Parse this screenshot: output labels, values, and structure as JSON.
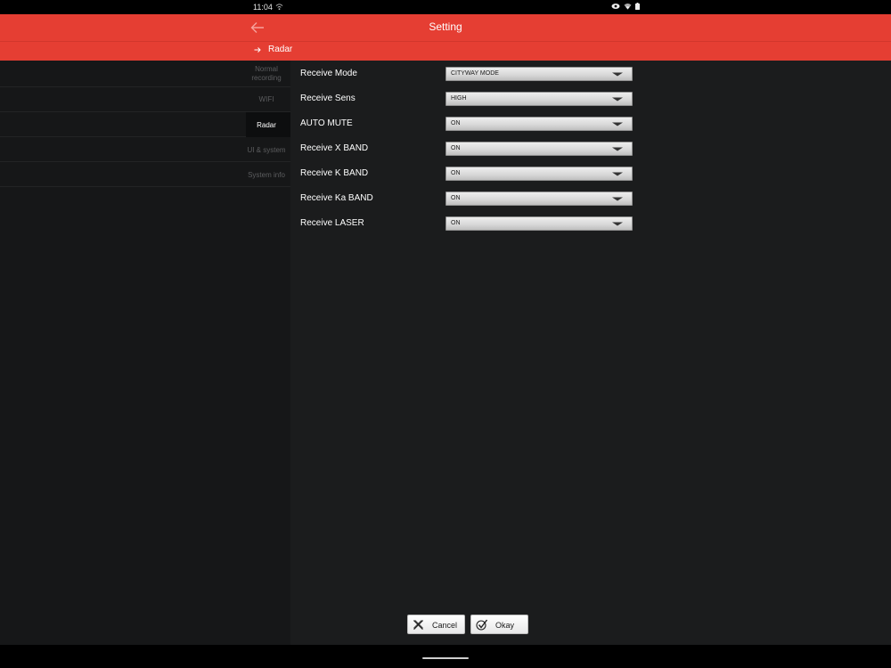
{
  "status_bar": {
    "time": "11:04"
  },
  "header": {
    "title": "Setting",
    "breadcrumb": "Radar"
  },
  "sidebar": {
    "items": [
      {
        "label": "Normal recording",
        "active": false
      },
      {
        "label": "WIFI",
        "active": false
      },
      {
        "label": "Radar",
        "active": true
      },
      {
        "label": "UI & system",
        "active": false
      },
      {
        "label": "System info",
        "active": false
      }
    ]
  },
  "settings": [
    {
      "label": "Receive Mode",
      "value": "CITYWAY MODE"
    },
    {
      "label": "Receive Sens",
      "value": "HIGH"
    },
    {
      "label": "AUTO MUTE",
      "value": "ON"
    },
    {
      "label": "Receive X BAND",
      "value": "ON"
    },
    {
      "label": "Receive K BAND",
      "value": "ON"
    },
    {
      "label": "Receive Ka BAND",
      "value": "ON"
    },
    {
      "label": "Receive LASER",
      "value": "ON"
    }
  ],
  "buttons": {
    "cancel_label": "Cancel",
    "okay_label": "Okay"
  },
  "colors": {
    "header_accent": "#e53e33",
    "sidebar_bg": "#161718",
    "content_bg": "#1b1c1d"
  },
  "icons": {
    "back": "arrow-left-icon",
    "breadcrumb": "arrow-right-icon",
    "dropdown": "chevron-down-icon",
    "cancel": "x-icon",
    "okay": "check-circle-icon"
  }
}
